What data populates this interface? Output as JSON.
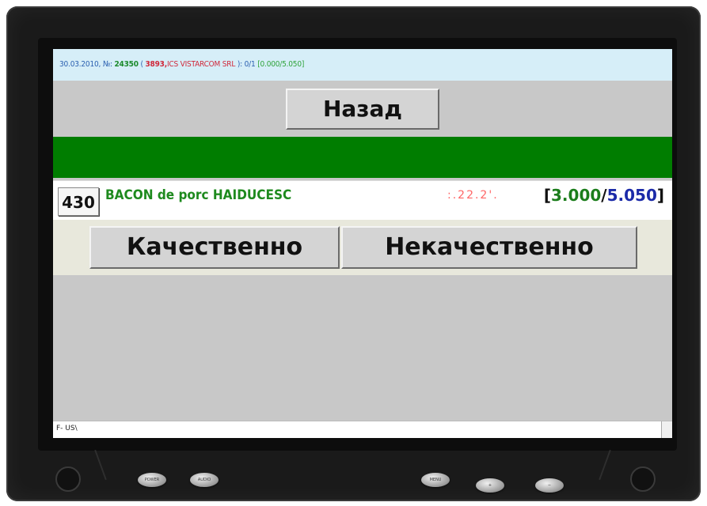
{
  "status_line": {
    "date": "30.03.2010,",
    "no_label": "№:",
    "order_number": "24350",
    "paren_open": "(",
    "client_code": "3893,",
    "client_name": "ICS VISTARCOM SRL",
    "paren_close": "):",
    "progress": "0/1",
    "weights": "[0.000/5.050]"
  },
  "back_button": {
    "label": "Назад"
  },
  "product": {
    "code": "430",
    "name": "BACON de porc HAIDUCESC",
    "extra": ":.22.2'.",
    "qty_open": "[",
    "qty_current": "3.000",
    "qty_sep": "/",
    "qty_total": "5.050",
    "qty_close": "]"
  },
  "quality_buttons": {
    "good_label": "Качественно",
    "bad_label": "Некачественно"
  },
  "bottom_bar": {
    "text": "F- US\\"
  },
  "hardware_buttons": {
    "power": "POWER",
    "audio": "AUDIO",
    "menu": "MENU",
    "plus": "+",
    "minus": "−"
  },
  "colors": {
    "status_background": "#d6eef8",
    "green_bar": "#007d00",
    "product_name": "#1e8a1e",
    "qty_current": "#1b7d1b",
    "qty_total": "#1b2aa8",
    "client": "#d0283a"
  }
}
